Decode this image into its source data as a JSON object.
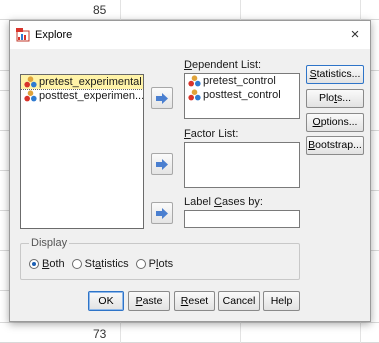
{
  "background": {
    "row_number_top": "85",
    "row_number_bottom": "73"
  },
  "dialog": {
    "title": "Explore",
    "close_glyph": "×",
    "icons": {
      "app": "explore-dialog-icon",
      "variable": "scale-variable-icon",
      "arrow": "move-right-arrow-icon"
    },
    "source_variables": [
      {
        "label": "pretest_experimental",
        "selected": true
      },
      {
        "label": "posttest_experimen...",
        "selected": false
      }
    ],
    "dependent_list": {
      "label_pre": "",
      "label_u": "D",
      "label_post": "ependent List:",
      "items": [
        "pretest_control",
        "posttest_control"
      ]
    },
    "factor_list": {
      "label_u": "F",
      "label_post": "actor List:"
    },
    "label_cases": {
      "label_pre": "Label ",
      "label_u": "C",
      "label_post": "ases by:",
      "value": ""
    },
    "side_buttons": [
      {
        "u": "S",
        "rest": "tatistics...",
        "name": "statistics-button"
      },
      {
        "u": "",
        "pre": "Plo",
        "uchar": "t",
        "rest": "s...",
        "name": "plots-button"
      },
      {
        "u": "O",
        "rest": "ptions...",
        "name": "options-button"
      },
      {
        "u": "B",
        "rest": "ootstrap...",
        "name": "bootstrap-button"
      }
    ],
    "display": {
      "legend": "Display",
      "options": [
        {
          "u": "B",
          "rest": "oth",
          "pre": "",
          "checked": true
        },
        {
          "pre": "St",
          "u": "a",
          "rest": "tistics",
          "checked": false
        },
        {
          "pre": "P",
          "u": "l",
          "rest": "ots",
          "checked": false
        }
      ]
    },
    "bottom_buttons": {
      "ok": "OK",
      "paste_u": "P",
      "paste_rest": "aste",
      "reset_u": "R",
      "reset_rest": "eset",
      "cancel": "Cancel",
      "help": "Help"
    },
    "colors": {
      "selection": "#fff3a8",
      "arrow": "#4a7fd0",
      "radio_on": "#1b5fb4",
      "focus_border": "#2e74c8"
    }
  }
}
